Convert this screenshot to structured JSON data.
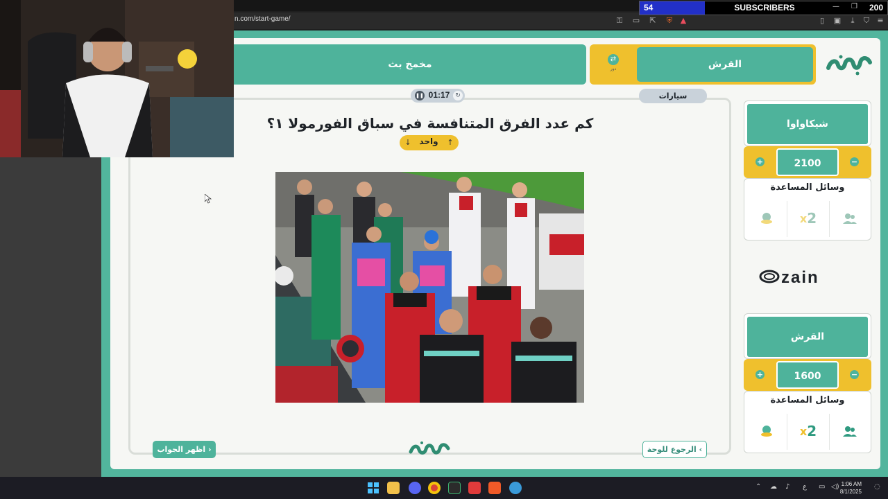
{
  "browser": {
    "url": "n.com/start-game/"
  },
  "overlay": {
    "subscriber_count": "54",
    "subscriber_label": "SUBSCRIBERS",
    "subscriber_goal": "200"
  },
  "header": {
    "left_team_button": "مخمخ بث",
    "active_team_button": "القرش",
    "turn_icon_label": "دور"
  },
  "question_card": {
    "timer": "01:17",
    "category": "سيارات",
    "question": "كم عدد الفرق المتنافسة في سباق الفورمولا ١؟",
    "points_label": "واحد",
    "show_answer_button": "اظهر الجواب",
    "back_to_board_button": "الرجوع للوحة"
  },
  "teams": [
    {
      "name": "شيكاواوا",
      "score": "2100",
      "aids_title": "وسائل المساعدة",
      "aids": [
        "call-friend-icon",
        "double-points-icon",
        "hole-icon"
      ]
    },
    {
      "name": "القرش",
      "score": "1600",
      "aids_title": "وسائل المساعدة",
      "aids": [
        "call-friend-icon",
        "double-points-icon",
        "hole-icon"
      ]
    }
  ],
  "sponsor": {
    "name": "zain"
  },
  "taskbar": {
    "time": "1:06 AM",
    "date": "8/1/2025",
    "lang": "ع"
  },
  "colors": {
    "brand_green": "#4eb39b",
    "accent_yellow": "#efc02d",
    "background": "#f6f7f4"
  }
}
